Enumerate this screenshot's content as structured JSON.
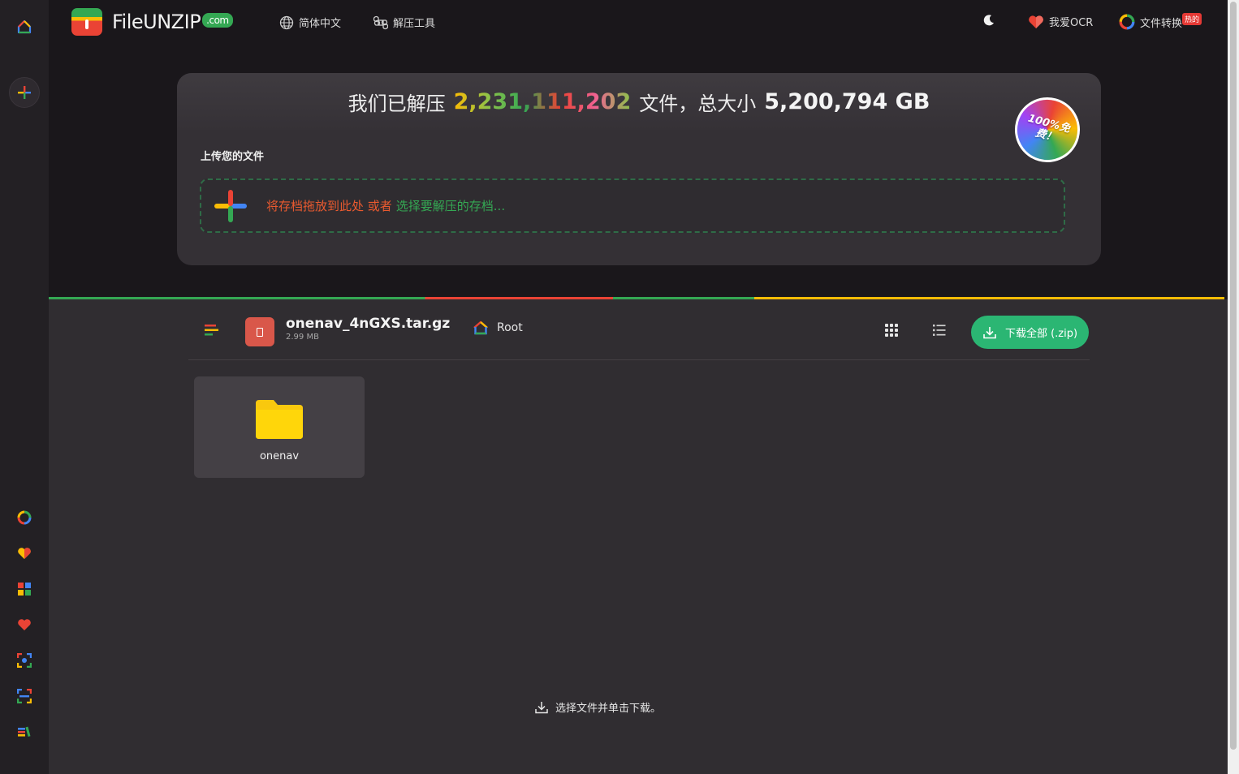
{
  "header": {
    "logo_main": "FileUNZIP",
    "logo_suffix": ".com",
    "nav": [
      {
        "label": "简体中文",
        "icon": "globe-icon"
      },
      {
        "label": "解压工具",
        "icon": "command-icon"
      }
    ],
    "right": [
      {
        "label": "我爱OCR",
        "icon": "heart-icon"
      },
      {
        "label": "文件转换",
        "icon": "convert-icon",
        "badge": "热的"
      }
    ],
    "theme_icon": "moon-icon"
  },
  "hero": {
    "prefix": "我们已解压",
    "count": "2,231,111,202",
    "middle": "文件，总大小",
    "size": "5,200,794 GB",
    "stamp": "100%免费！",
    "upload_label": "上传您的文件",
    "drop_text": "将存档拖放到此处 或者",
    "drop_link": "选择要解压的存档..."
  },
  "archive": {
    "name": "onenav_4nGXS.tar.gz",
    "size": "2.99 MB",
    "crumb": "Root",
    "download_all": "下载全部 (.zip)"
  },
  "files": [
    {
      "name": "onenav",
      "type": "folder"
    }
  ],
  "hint": "选择文件并单击下载。",
  "colors": {
    "accent_green": "#2bb673",
    "brand_red": "#ea4335",
    "brand_yellow": "#fbbc05",
    "brand_blue": "#4285f4"
  }
}
